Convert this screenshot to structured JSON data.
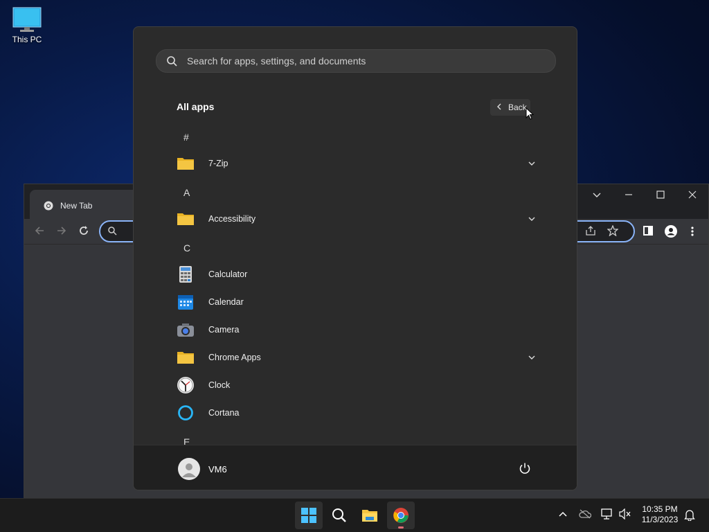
{
  "desktop": {
    "this_pc_label": "This PC"
  },
  "chrome": {
    "tab_title": "New Tab"
  },
  "start_menu": {
    "search_placeholder": "Search for apps, settings, and documents",
    "section_title": "All apps",
    "back_label": "Back",
    "groups": [
      {
        "letter": "#",
        "apps": [
          {
            "name": "7-Zip",
            "icon": "folder-icon",
            "expandable": true
          }
        ]
      },
      {
        "letter": "A",
        "apps": [
          {
            "name": "Accessibility",
            "icon": "folder-icon",
            "expandable": true
          }
        ]
      },
      {
        "letter": "C",
        "apps": [
          {
            "name": "Calculator",
            "icon": "calculator-icon",
            "expandable": false
          },
          {
            "name": "Calendar",
            "icon": "calendar-icon",
            "expandable": false
          },
          {
            "name": "Camera",
            "icon": "camera-icon",
            "expandable": false
          },
          {
            "name": "Chrome Apps",
            "icon": "folder-icon",
            "expandable": true
          },
          {
            "name": "Clock",
            "icon": "clock-icon",
            "expandable": false
          },
          {
            "name": "Cortana",
            "icon": "cortana-icon",
            "expandable": false
          }
        ]
      },
      {
        "letter": "E",
        "apps": []
      }
    ],
    "user_name": "VM6"
  },
  "taskbar": {
    "time": "10:35 PM",
    "date": "11/3/2023"
  },
  "colors": {
    "accent": "#8ab4f8",
    "folder": "#f4c542"
  }
}
